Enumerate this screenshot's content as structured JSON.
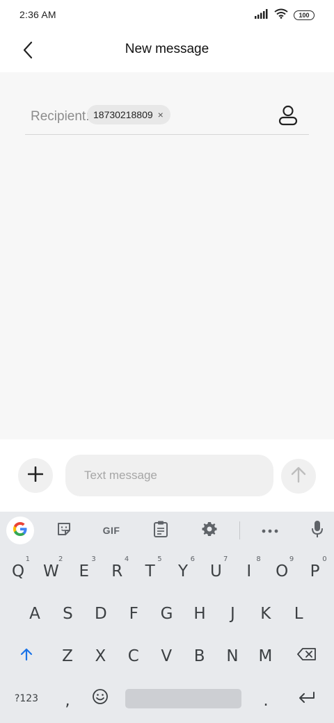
{
  "status_bar": {
    "time": "2:36 AM",
    "battery": "100"
  },
  "header": {
    "title": "New message"
  },
  "recipient": {
    "label": "Recipient:",
    "chip_text": "18730218809",
    "chip_close": "×"
  },
  "compose": {
    "placeholder": "Text message"
  },
  "keyboard": {
    "toolbar": {
      "gif_label": "GIF"
    },
    "row1": [
      {
        "key": "Q",
        "hint": "1"
      },
      {
        "key": "W",
        "hint": "2"
      },
      {
        "key": "E",
        "hint": "3"
      },
      {
        "key": "R",
        "hint": "4"
      },
      {
        "key": "T",
        "hint": "5"
      },
      {
        "key": "Y",
        "hint": "6"
      },
      {
        "key": "U",
        "hint": "7"
      },
      {
        "key": "I",
        "hint": "8"
      },
      {
        "key": "O",
        "hint": "9"
      },
      {
        "key": "P",
        "hint": "0"
      }
    ],
    "row2": [
      "A",
      "S",
      "D",
      "F",
      "G",
      "H",
      "J",
      "K",
      "L"
    ],
    "row3": [
      "Z",
      "X",
      "C",
      "V",
      "B",
      "N",
      "M"
    ],
    "bottom": {
      "symbols_label": "?123",
      "comma": ",",
      "period": "."
    }
  },
  "colors": {
    "accent_blue": "#1a73e8",
    "content_bg": "#f7f7f7",
    "keyboard_bg": "#e8eaed"
  },
  "icons": {
    "back": "back-arrow-icon",
    "contact": "person-icon",
    "add": "plus-icon",
    "send": "arrow-up-icon",
    "google": "google-g-icon",
    "sticker": "sticker-icon",
    "clipboard": "clipboard-icon",
    "settings": "gear-icon",
    "more": "more-icon",
    "mic": "mic-icon",
    "shift": "shift-arrow-icon",
    "backspace": "backspace-icon",
    "emoji": "emoji-icon",
    "enter": "enter-icon"
  }
}
